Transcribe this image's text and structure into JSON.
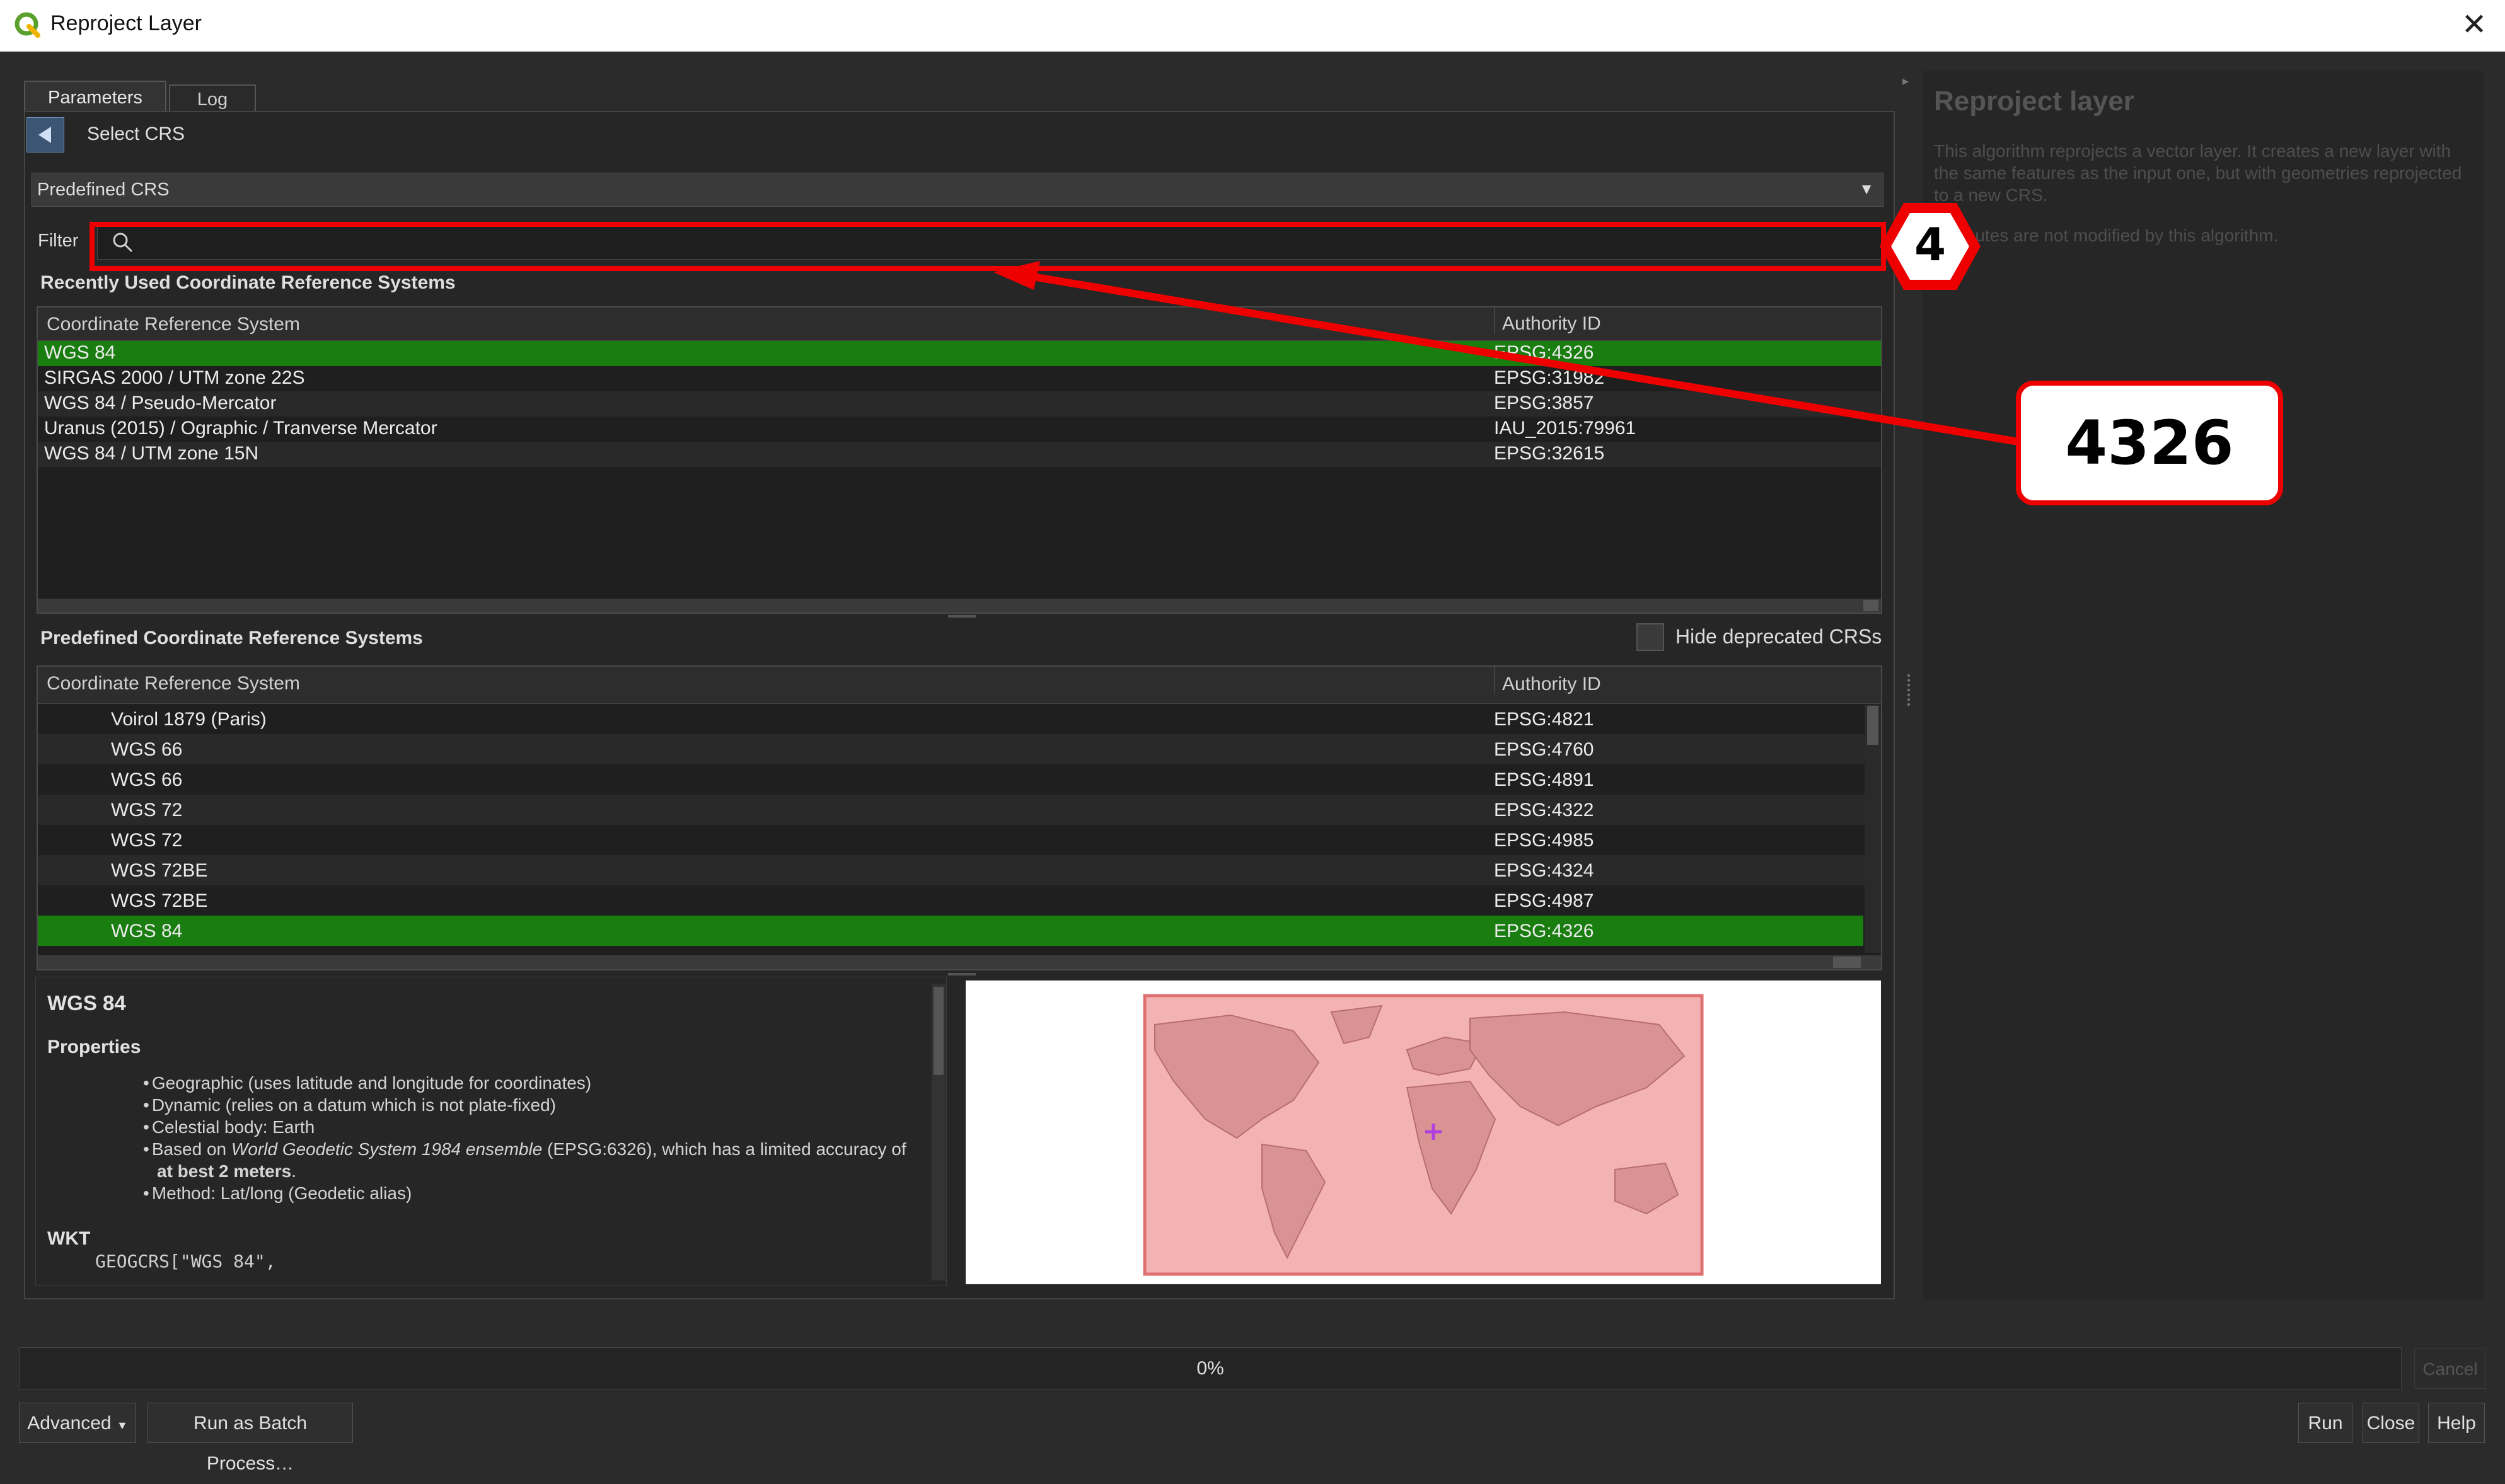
{
  "window": {
    "title": "Reproject Layer",
    "close_glyph": "✕"
  },
  "tabs": [
    {
      "label": "Parameters"
    },
    {
      "label": "Log"
    }
  ],
  "crs_selector": {
    "header_label": "Select CRS",
    "combo_value": "Predefined CRS",
    "filter_label": "Filter",
    "filter_value": "",
    "recent": {
      "title": "Recently Used Coordinate Reference Systems",
      "col_crs": "Coordinate Reference System",
      "col_auth": "Authority ID",
      "rows": [
        {
          "name": "WGS 84",
          "auth": "EPSG:4326",
          "selected": true
        },
        {
          "name": "SIRGAS 2000 / UTM zone 22S",
          "auth": "EPSG:31982"
        },
        {
          "name": "WGS 84 / Pseudo-Mercator",
          "auth": "EPSG:3857"
        },
        {
          "name": "Uranus (2015) / Ographic / Tranverse Mercator",
          "auth": "IAU_2015:79961"
        },
        {
          "name": "WGS 84 / UTM zone 15N",
          "auth": "EPSG:32615"
        }
      ]
    },
    "predefined": {
      "title": "Predefined Coordinate Reference Systems",
      "hide_deprecated_label": "Hide deprecated CRSs",
      "hide_deprecated_checked": false,
      "col_crs": "Coordinate Reference System",
      "col_auth": "Authority ID",
      "rows": [
        {
          "name": "Voirol 1879 (Paris)",
          "auth": "EPSG:4821"
        },
        {
          "name": "WGS 66",
          "auth": "EPSG:4760"
        },
        {
          "name": "WGS 66",
          "auth": "EPSG:4891"
        },
        {
          "name": "WGS 72",
          "auth": "EPSG:4322"
        },
        {
          "name": "WGS 72",
          "auth": "EPSG:4985"
        },
        {
          "name": "WGS 72BE",
          "auth": "EPSG:4324"
        },
        {
          "name": "WGS 72BE",
          "auth": "EPSG:4987"
        },
        {
          "name": "WGS 84",
          "auth": "EPSG:4326",
          "selected": true
        }
      ]
    },
    "details": {
      "crs_name": "WGS 84",
      "properties_heading": "Properties",
      "b1": "Geographic (uses latitude and longitude for coordinates)",
      "b2": "Dynamic (relies on a datum which is not plate-fixed)",
      "b3": "Celestial body: Earth",
      "b4_pre": "Based on ",
      "b4_italic": "World Geodetic System 1984 ensemble",
      "b4_post": " (EPSG:6326), which has a limited accuracy of",
      "b4_bold": "at best 2 meters",
      "b4_end": ".",
      "b5": "Method: Lat/long (Geodetic alias)",
      "wkt_heading": "WKT",
      "wkt_text": "GEOGCRS[\"WGS 84\","
    }
  },
  "help_panel": {
    "title": "Reproject layer",
    "text": "This algorithm reprojects a vector layer. It creates a new layer with the same features as the input one, but with geometries reprojected to a new CRS.",
    "text2": "Attributes are not modified by this algorithm."
  },
  "progress": {
    "label": "0%",
    "value": 0
  },
  "buttons": {
    "cancel": "Cancel",
    "advanced": "Advanced",
    "batch": "Run as Batch Process…",
    "run": "Run",
    "close": "Close",
    "help": "Help"
  },
  "annotations": {
    "step_badge": "4",
    "callout_text": "4326"
  },
  "colors": {
    "selected_row": "#1a7d10",
    "callout_red": "#ee0000",
    "map_extent": "#f4b3b3"
  }
}
